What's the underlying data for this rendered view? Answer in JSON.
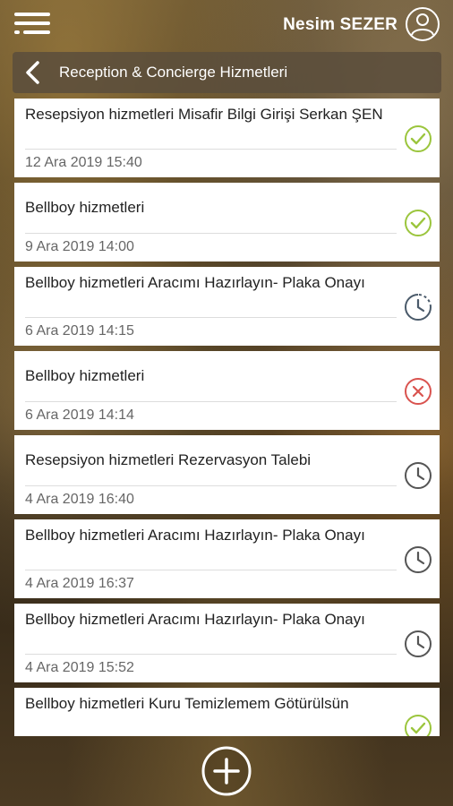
{
  "topbar": {
    "user_name": "Nesim SEZER"
  },
  "header": {
    "title": "Reception & Concierge Hizmetleri"
  },
  "colors": {
    "completed": "#9bc53d",
    "cancelled": "#d9534f",
    "pending": "#555555",
    "in_progress": "#4a5a6a"
  },
  "requests": [
    {
      "title": "Resepsiyon hizmetleri Misafir Bilgi Girişi Serkan ŞEN",
      "date": "12 Ara 2019 15:40",
      "status": "completed"
    },
    {
      "title": "Bellboy hizmetleri",
      "date": "9 Ara 2019 14:00",
      "status": "completed"
    },
    {
      "title": "Bellboy hizmetleri Aracımı Hazırlayın- Plaka Onayı",
      "date": "6 Ara 2019 14:15",
      "status": "in_progress"
    },
    {
      "title": "Bellboy hizmetleri",
      "date": "6 Ara 2019 14:14",
      "status": "cancelled"
    },
    {
      "title": "Resepsiyon hizmetleri Rezervasyon Talebi",
      "date": "4 Ara 2019 16:40",
      "status": "pending"
    },
    {
      "title": "Bellboy hizmetleri Aracımı Hazırlayın- Plaka Onayı",
      "date": "4 Ara 2019 16:37",
      "status": "pending"
    },
    {
      "title": "Bellboy hizmetleri Aracımı Hazırlayın- Plaka Onayı",
      "date": "4 Ara 2019 15:52",
      "status": "pending"
    },
    {
      "title": "Bellboy hizmetleri Kuru Temizlemem Götürülsün",
      "date": "",
      "status": "completed"
    }
  ]
}
